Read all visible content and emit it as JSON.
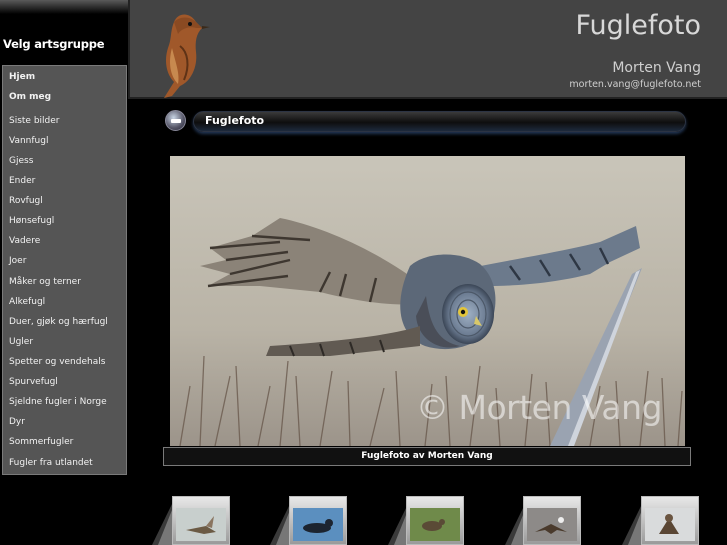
{
  "sidebar": {
    "title": "Velg artsgruppe",
    "items": [
      {
        "label": "Hjem",
        "bold": true
      },
      {
        "label": "Om meg",
        "bold": true
      },
      {
        "label": "Siste bilder"
      },
      {
        "label": "Vannfugl"
      },
      {
        "label": "Gjess"
      },
      {
        "label": "Ender"
      },
      {
        "label": "Rovfugl"
      },
      {
        "label": "Hønsefugl"
      },
      {
        "label": "Vadere"
      },
      {
        "label": "Joer"
      },
      {
        "label": "Måker og terner"
      },
      {
        "label": "Alkefugl"
      },
      {
        "label": "Duer, gjøk og hærfugl"
      },
      {
        "label": "Ugler"
      },
      {
        "label": "Spetter og vendehals"
      },
      {
        "label": "Spurvefugl"
      },
      {
        "label": "Sjeldne fugler i Norge"
      },
      {
        "label": "Dyr"
      },
      {
        "label": "Sommerfugler"
      },
      {
        "label": "Fugler fra utlandet"
      }
    ]
  },
  "header": {
    "title": "Fuglefoto",
    "name": "Morten Vang",
    "email": "morten.vang@fuglefoto.net"
  },
  "section": {
    "title": "Fuglefoto"
  },
  "photo": {
    "watermark": "© Morten Vang",
    "caption": "Fuglefoto av Morten Vang"
  },
  "colors": {
    "background": "#000000",
    "header_bg": "#444444",
    "menu_bg": "#555555",
    "section_glow": "#466eaa"
  },
  "thumbnails": [
    {
      "icon": "sandpiper-thumbnail"
    },
    {
      "icon": "diver-thumbnail"
    },
    {
      "icon": "wader-grass-thumbnail"
    },
    {
      "icon": "eagle-thumbnail"
    },
    {
      "icon": "raptor-snow-thumbnail"
    }
  ]
}
